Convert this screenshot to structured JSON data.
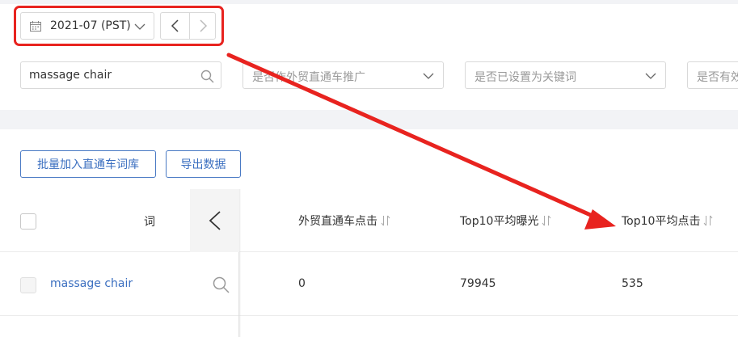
{
  "date_picker": {
    "value": "2021-07 (PST)",
    "icon": "calendar-icon",
    "prev_icon": "chevron-left-icon",
    "next_icon": "chevron-right-icon"
  },
  "filters": {
    "search_value": "massage chair",
    "search_icon": "search-icon",
    "select1_placeholder": "是否作外贸直通车推广",
    "select2_placeholder": "是否已设置为关键词",
    "select3_placeholder": "是否有效"
  },
  "actions": {
    "batch_add_label": "批量加入直通车词库",
    "export_label": "导出数据"
  },
  "table": {
    "columns": [
      {
        "label": "词"
      },
      {
        "label": "外贸直通车点击"
      },
      {
        "label": "Top10平均曝光"
      },
      {
        "label": "Top10平均点击"
      }
    ],
    "rows": [
      {
        "keyword": "massage chair",
        "clicks": "0",
        "top10_impressions": "79945",
        "top10_clicks": "535"
      }
    ]
  },
  "colors": {
    "accent": "#3b6fc0",
    "annotation": "#e8231f",
    "border": "#d9d9d9"
  }
}
